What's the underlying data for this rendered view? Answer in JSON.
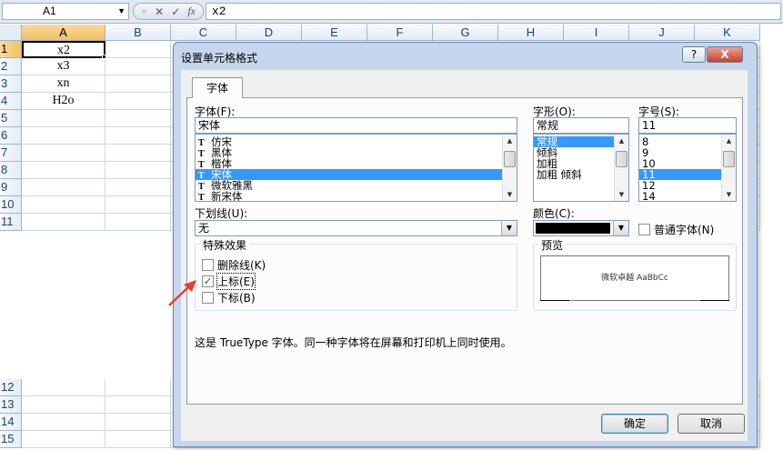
{
  "formula_bar": {
    "name_box": "A1",
    "name_box_arrow": "▼",
    "fx_icons": [
      "◦",
      "✕",
      "✓",
      "fx"
    ],
    "formula": "x2"
  },
  "sheet": {
    "columns": [
      "A",
      "B",
      "C",
      "D",
      "E",
      "F",
      "G",
      "H",
      "I",
      "J",
      "K"
    ],
    "rows": [
      "1",
      "2",
      "3",
      "4",
      "5",
      "6",
      "7",
      "8",
      "9",
      "10",
      "11",
      "12",
      "13",
      "14",
      "15"
    ],
    "cells": {
      "A1": "x2",
      "A2": "x3",
      "A3": "xn",
      "A4": "H2o"
    },
    "selected_cell": "A1"
  },
  "dialog": {
    "title": "设置单元格格式",
    "help_label": "?",
    "close_label": "X",
    "tab_label": "字体",
    "font": {
      "label": "字体(F):",
      "value": "宋体",
      "items": [
        "仿宋",
        "黑体",
        "楷体",
        "宋体",
        "微软雅黑",
        "新宋体"
      ],
      "selected": "宋体"
    },
    "style": {
      "label": "字形(O):",
      "value": "常规",
      "items": [
        "常规",
        "倾斜",
        "加粗",
        "加粗 倾斜"
      ],
      "selected": "常规"
    },
    "size": {
      "label": "字号(S):",
      "value": "11",
      "items": [
        "8",
        "9",
        "10",
        "11",
        "12",
        "14"
      ],
      "selected": "11"
    },
    "underline": {
      "label": "下划线(U):",
      "value": "无"
    },
    "color": {
      "label": "颜色(C):",
      "swatch": "#000000"
    },
    "normal_font": {
      "label": "普通字体(N)",
      "checked": false
    },
    "effects": {
      "title": "特殊效果",
      "strikethrough": {
        "label": "删除线(K)",
        "checked": false
      },
      "superscript": {
        "label": "上标(E)",
        "checked": true,
        "check_glyph": "✓"
      },
      "subscript": {
        "label": "下标(B)",
        "checked": false
      }
    },
    "preview": {
      "title": "预览",
      "sample": "微软卓越  AaBbCc"
    },
    "info_text": "这是 TrueType 字体。同一种字体将在屏幕和打印机上同时使用。",
    "ok_label": "确定",
    "cancel_label": "取消"
  },
  "annotation": {
    "arrow_color": "#e8402e"
  }
}
